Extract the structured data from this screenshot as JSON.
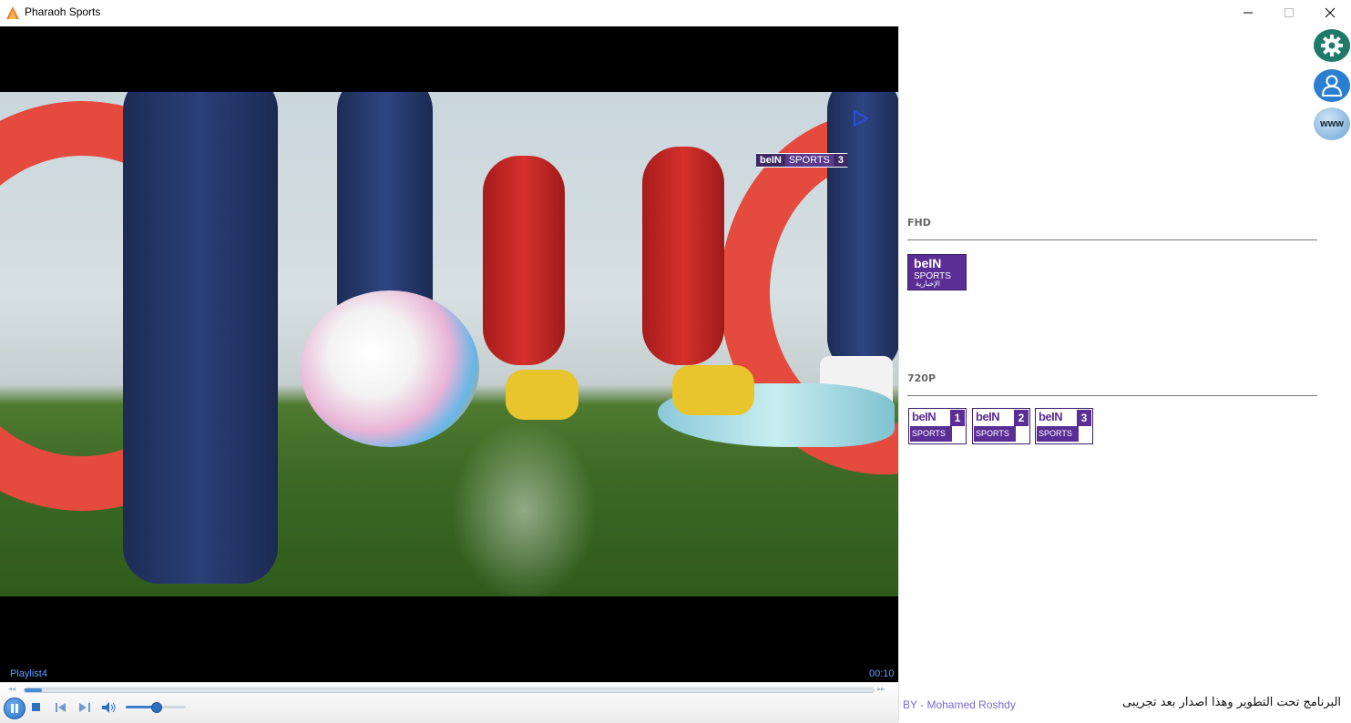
{
  "window": {
    "title": "Pharaoh Sports"
  },
  "player": {
    "playlist_name": "Playlist4",
    "elapsed_time": "00:10",
    "seek_progress": 0.02,
    "volume_level": 0.5,
    "overlay_channel": {
      "brand": "beIN",
      "label": "SPORTS",
      "number": "3"
    }
  },
  "sections": [
    {
      "label": "FHD",
      "channels": [
        {
          "logo": "beIN",
          "sub": "SPORTS",
          "tag": "الإخبارية"
        }
      ]
    },
    {
      "label": "720P",
      "channels": [
        {
          "logo": "beIN",
          "number": "1",
          "sub": "SPORTS"
        },
        {
          "logo": "beIN",
          "number": "2",
          "sub": "SPORTS"
        },
        {
          "logo": "beIN",
          "number": "3",
          "sub": "SPORTS"
        }
      ]
    }
  ],
  "side_buttons": {
    "settings_icon": "gear-icon",
    "user_icon": "user-icon",
    "web_label": "www"
  },
  "footer": {
    "author": "BY - Mohamed Roshdy",
    "notice": "البرنامج تحت التطوير وهذا اصدار بعد تجريبى"
  },
  "colors": {
    "bein_purple": "#5a2e95",
    "accent_blue": "#5b9cff",
    "settings_green": "#1f7a6a",
    "user_blue": "#2b7fd0"
  }
}
